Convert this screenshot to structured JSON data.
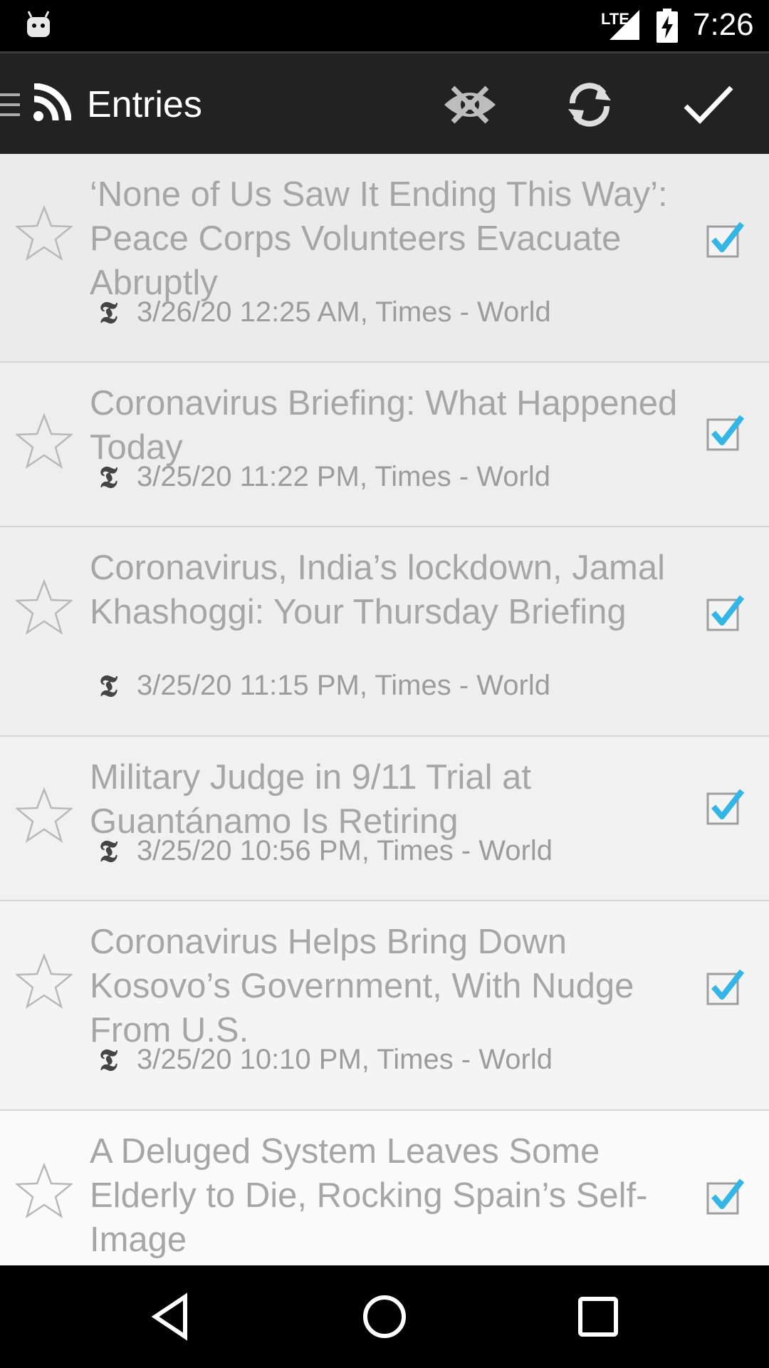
{
  "status_bar": {
    "network": "LTE",
    "time": "7:26"
  },
  "toolbar": {
    "title": "Entries",
    "icons": [
      "menu-icon",
      "rss-icon",
      "hide-read-icon",
      "refresh-icon",
      "mark-all-read-icon"
    ]
  },
  "entries": [
    {
      "headline": "‘None of Us Saw It Ending This Way’: Peace Corps Volunteers Evacuate Abruptly",
      "meta": "3/26/20 12:25 AM, Times - World",
      "checked": true
    },
    {
      "headline": "Coronavirus Briefing: What Happened Today",
      "meta": "3/25/20 11:22 PM, Times - World",
      "checked": true
    },
    {
      "headline": "Coronavirus, India’s lockdown, Jamal Khashoggi: Your Thursday Briefing",
      "meta": "3/25/20 11:15 PM, Times - World",
      "checked": true
    },
    {
      "headline": "Military Judge in 9/11 Trial at Guantánamo Is Retiring",
      "meta": "3/25/20 10:56 PM, Times - World",
      "checked": true
    },
    {
      "headline": "Coronavirus Helps Bring Down Kosovo’s Government, With Nudge From U.S.",
      "meta": "3/25/20 10:10 PM, Times - World",
      "checked": true
    },
    {
      "headline": "A Deluged System Leaves Some Elderly to Die, Rocking Spain’s Self-Image",
      "meta": "",
      "checked": true
    }
  ],
  "feed_logo": "𝕿",
  "colors": {
    "checkbox_check": "#33b5e5",
    "toolbar_bg": "#222222",
    "headline_text": "#a6a6a6"
  }
}
